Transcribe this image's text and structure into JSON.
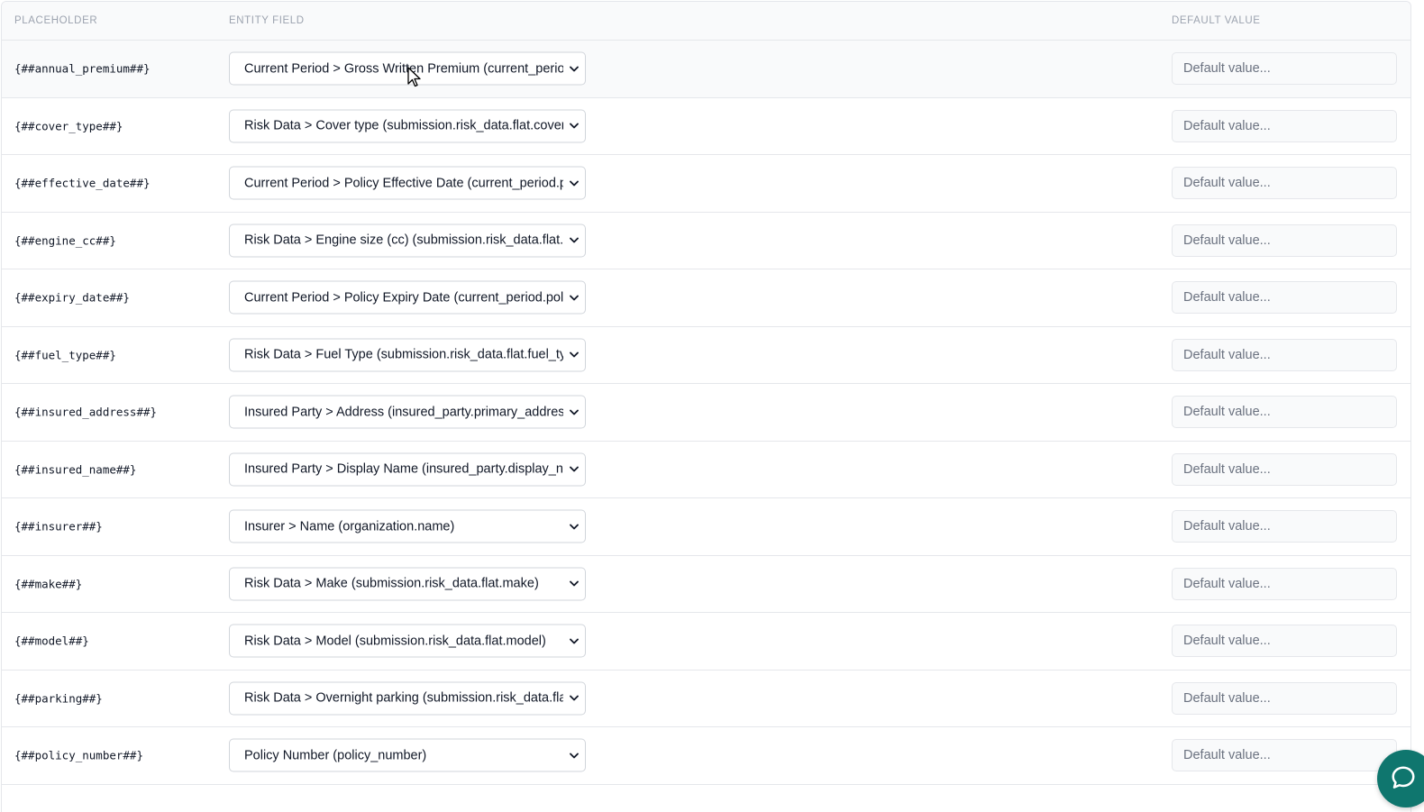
{
  "headers": {
    "placeholder": "PLACEHOLDER",
    "entity_field": "ENTITY FIELD",
    "default_value": "DEFAULT VALUE"
  },
  "default_placeholder": "Default value...",
  "rows": [
    {
      "placeholder": "{##annual_premium##}",
      "field": "Current Period > Gross Written Premium (current_period.gross_written_premium)"
    },
    {
      "placeholder": "{##cover_type##}",
      "field": "Risk Data > Cover type (submission.risk_data.flat.cover_type)"
    },
    {
      "placeholder": "{##effective_date##}",
      "field": "Current Period > Policy Effective Date (current_period.policy_effective_date)"
    },
    {
      "placeholder": "{##engine_cc##}",
      "field": "Risk Data > Engine size (cc) (submission.risk_data.flat.engine_cc)"
    },
    {
      "placeholder": "{##expiry_date##}",
      "field": "Current Period > Policy Expiry Date (current_period.policy_expiry_date)"
    },
    {
      "placeholder": "{##fuel_type##}",
      "field": "Risk Data > Fuel Type (submission.risk_data.flat.fuel_type)"
    },
    {
      "placeholder": "{##insured_address##}",
      "field": "Insured Party > Address (insured_party.primary_address)"
    },
    {
      "placeholder": "{##insured_name##}",
      "field": "Insured Party > Display Name (insured_party.display_name)"
    },
    {
      "placeholder": "{##insurer##}",
      "field": "Insurer > Name (organization.name)"
    },
    {
      "placeholder": "{##make##}",
      "field": "Risk Data > Make (submission.risk_data.flat.make)"
    },
    {
      "placeholder": "{##model##}",
      "field": "Risk Data > Model (submission.risk_data.flat.model)"
    },
    {
      "placeholder": "{##parking##}",
      "field": "Risk Data > Overnight parking (submission.risk_data.flat.parking)"
    },
    {
      "placeholder": "{##policy_number##}",
      "field": "Policy Number (policy_number)"
    }
  ],
  "colors": {
    "header_bg": "#f9fafb",
    "border": "#e5e7eb",
    "chat_accent": "#0f766e"
  },
  "icons": {
    "select_chevron": "chevron-down-icon",
    "chat": "chat-bubble-icon",
    "cursor": "mouse-pointer-icon"
  }
}
